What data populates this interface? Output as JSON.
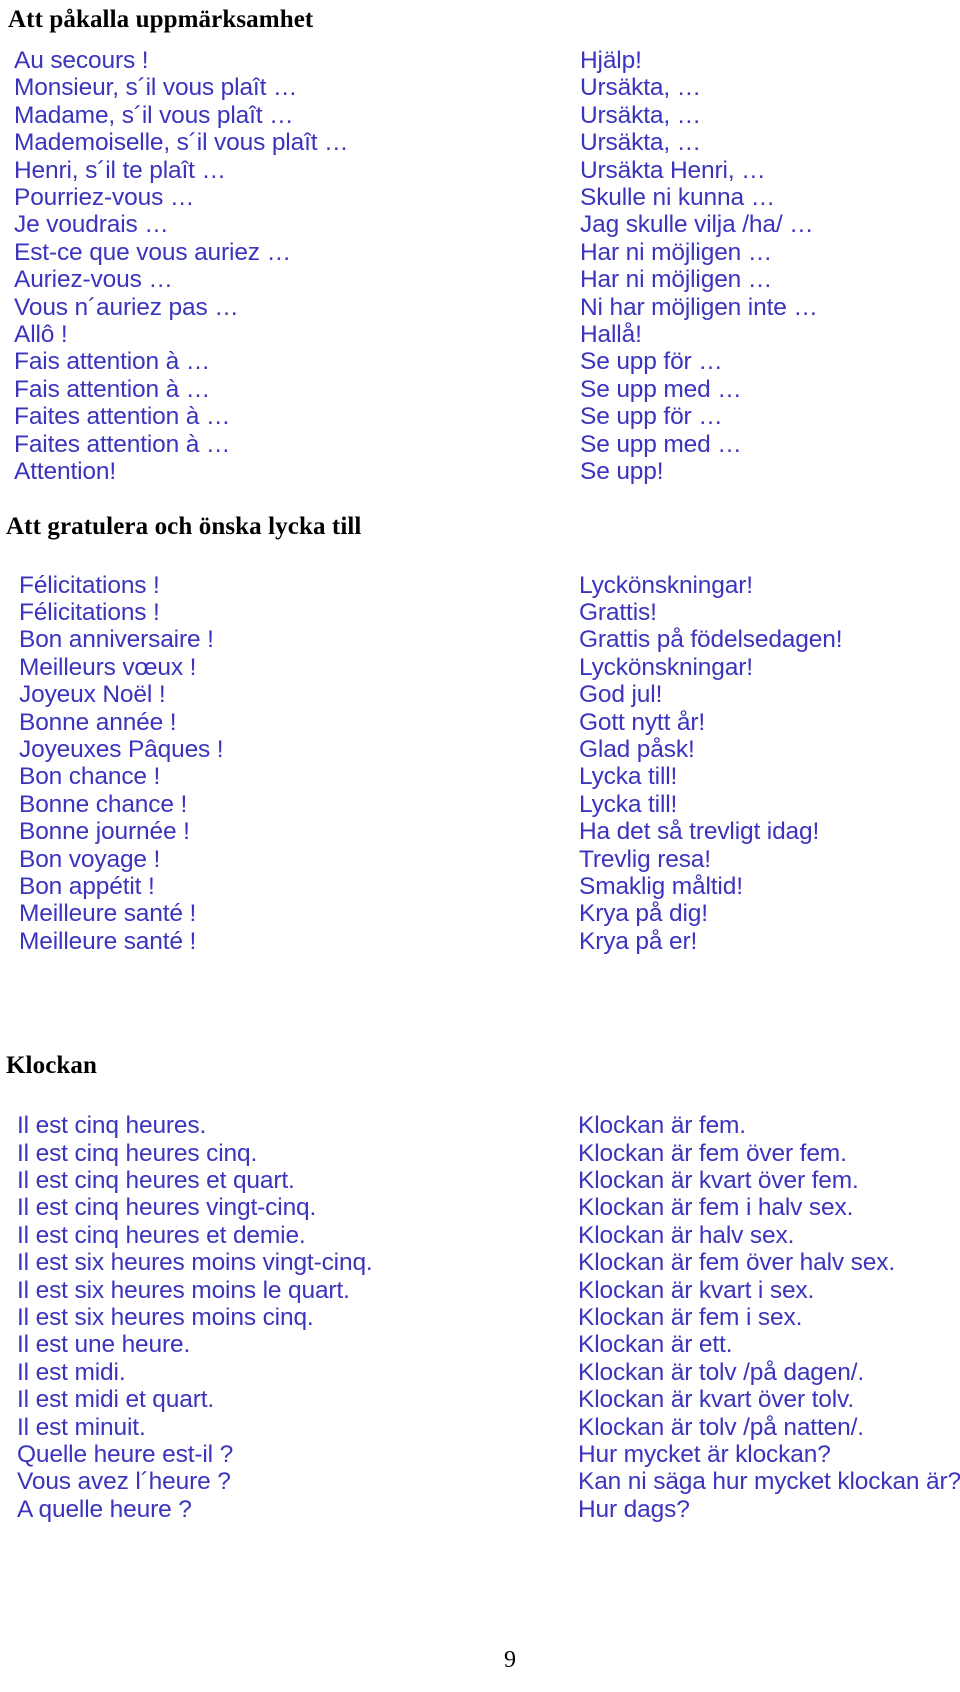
{
  "document": {
    "page_number": "9",
    "text_color": "#3b34bd",
    "heading_color": "#000000",
    "background_color": "#ffffff"
  },
  "sections": [
    {
      "heading": "Att påkalla uppmärksamhet",
      "french": [
        "Au secours !",
        "Monsieur, s´il vous plaît …",
        "Madame, s´il vous plaît …",
        "Mademoiselle, s´il vous plaît …",
        "Henri, s´il te plaît …",
        "Pourriez-vous …",
        "Je voudrais …",
        "Est-ce que vous auriez …",
        "Auriez-vous …",
        "Vous n´auriez pas …",
        "Allô !",
        "Fais attention à …",
        "Fais attention à …",
        "Faites attention à …",
        "Faites attention à …",
        "Attention!"
      ],
      "swedish": [
        "Hjälp!",
        "Ursäkta, …",
        "Ursäkta, …",
        "Ursäkta, …",
        "Ursäkta Henri, …",
        "Skulle ni kunna …",
        "Jag skulle vilja /ha/ …",
        "Har ni möjligen …",
        "Har ni möjligen …",
        "Ni har möjligen inte …",
        "Hallå!",
        "Se upp för …",
        "Se upp med …",
        "Se upp för …",
        "Se upp med …",
        "Se upp!"
      ]
    },
    {
      "heading": "Att gratulera och önska lycka till",
      "french": [
        "Félicitations !",
        "Félicitations !",
        "Bon anniversaire !",
        "Meilleurs vœux !",
        "Joyeux Noël !",
        "Bonne année !",
        "Joyeuxes Pâques !",
        "Bon chance !",
        "Bonne chance !",
        "Bonne journée !",
        "Bon voyage !",
        "Bon appétit !",
        "Meilleure santé !",
        "Meilleure santé !"
      ],
      "swedish": [
        "Lyckönskningar!",
        "Grattis!",
        "Grattis på födelsedagen!",
        "Lyckönskningar!",
        "God jul!",
        "Gott nytt år!",
        "Glad påsk!",
        "Lycka till!",
        "Lycka till!",
        "Ha det så trevligt idag!",
        "Trevlig resa!",
        "Smaklig måltid!",
        "Krya på dig!",
        "Krya på er!"
      ]
    },
    {
      "heading": "Klockan",
      "french": [
        "Il est cinq heures.",
        "Il est cinq heures cinq.",
        "Il est cinq heures et quart.",
        "Il est cinq heures vingt-cinq.",
        "Il est cinq heures et demie.",
        "Il est six heures moins vingt-cinq.",
        "Il est six heures moins le quart.",
        "Il est six heures moins cinq.",
        "Il est une heure.",
        "Il est midi.",
        "Il est midi et quart.",
        "Il est minuit.",
        "Quelle heure est-il ?",
        "Vous avez l´heure ?",
        "A quelle heure ?"
      ],
      "swedish": [
        "Klockan är fem.",
        "Klockan är fem över fem.",
        "Klockan är kvart över fem.",
        "Klockan är fem i halv sex.",
        "Klockan är halv sex.",
        "Klockan är fem över halv sex.",
        "Klockan är kvart i sex.",
        "Klockan är fem i sex.",
        "Klockan är ett.",
        "Klockan är tolv /på dagen/.",
        "Klockan är kvart över tolv.",
        "Klockan är tolv /på natten/.",
        "Hur mycket är klockan?",
        "Kan ni säga hur mycket klockan är?",
        "Hur dags?"
      ]
    }
  ]
}
